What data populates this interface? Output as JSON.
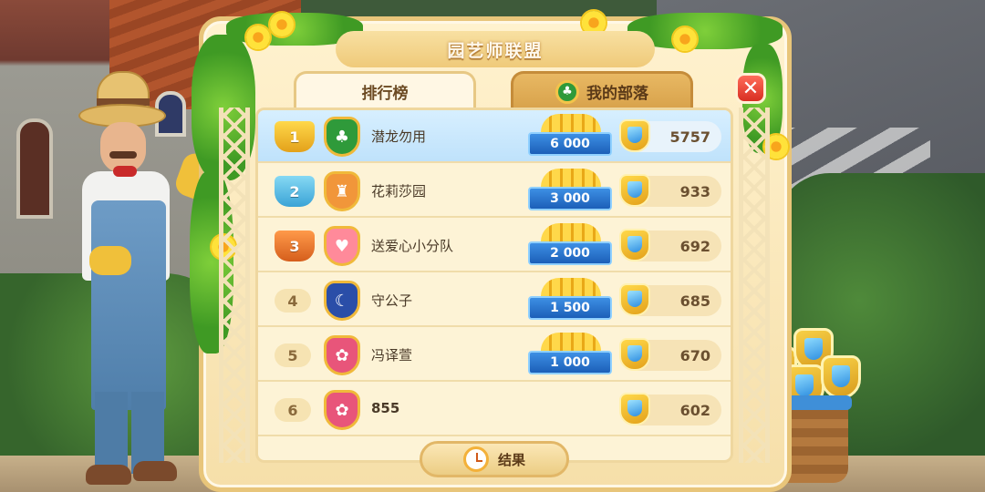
{
  "panel": {
    "title": "园艺师联盟"
  },
  "tabs": [
    {
      "label": "排行榜",
      "active": true
    },
    {
      "label": "我的部落",
      "active": false,
      "icon": "clover-icon"
    }
  ],
  "close": {
    "label": "✕"
  },
  "leaderboard": [
    {
      "rank": "1",
      "rank_style": "gold-cup",
      "team_icon": "clover-badge",
      "team_color": "#2f9a3a",
      "name": "潜龙勿用",
      "prize": "6 000",
      "score": "5757",
      "highlight": true
    },
    {
      "rank": "2",
      "rank_style": "silver-cup",
      "team_icon": "castle-badge",
      "team_color": "#f1963a",
      "name": "花莉莎园",
      "prize": "3 000",
      "score": "933",
      "highlight": false
    },
    {
      "rank": "3",
      "rank_style": "bronze-cup",
      "team_icon": "heart-badge",
      "team_color": "#ff8a9a",
      "name": "送爱心小分队",
      "prize": "2 000",
      "score": "692",
      "highlight": false
    },
    {
      "rank": "4",
      "rank_style": "plain",
      "team_icon": "moon-badge",
      "team_color": "#2a4ea8",
      "name": "守公子",
      "prize": "1 500",
      "score": "685",
      "highlight": false
    },
    {
      "rank": "5",
      "rank_style": "plain",
      "team_icon": "flower-badge",
      "team_color": "#e8557a",
      "name": "冯译萱",
      "prize": "1 000",
      "score": "670",
      "highlight": false
    },
    {
      "rank": "6",
      "rank_style": "plain",
      "team_icon": "flower-badge",
      "team_color": "#e8557a",
      "name": "855",
      "prize": "",
      "score": "602",
      "highlight": false
    }
  ],
  "result_button": {
    "label": "结果",
    "icon": "alarm-clock-icon"
  },
  "colors": {
    "highlight_row": "#bfe2fb",
    "prize_ribbon": "#1c5fb8",
    "close_button": "#d82e22",
    "panel_bg": "#fdf3d6"
  }
}
